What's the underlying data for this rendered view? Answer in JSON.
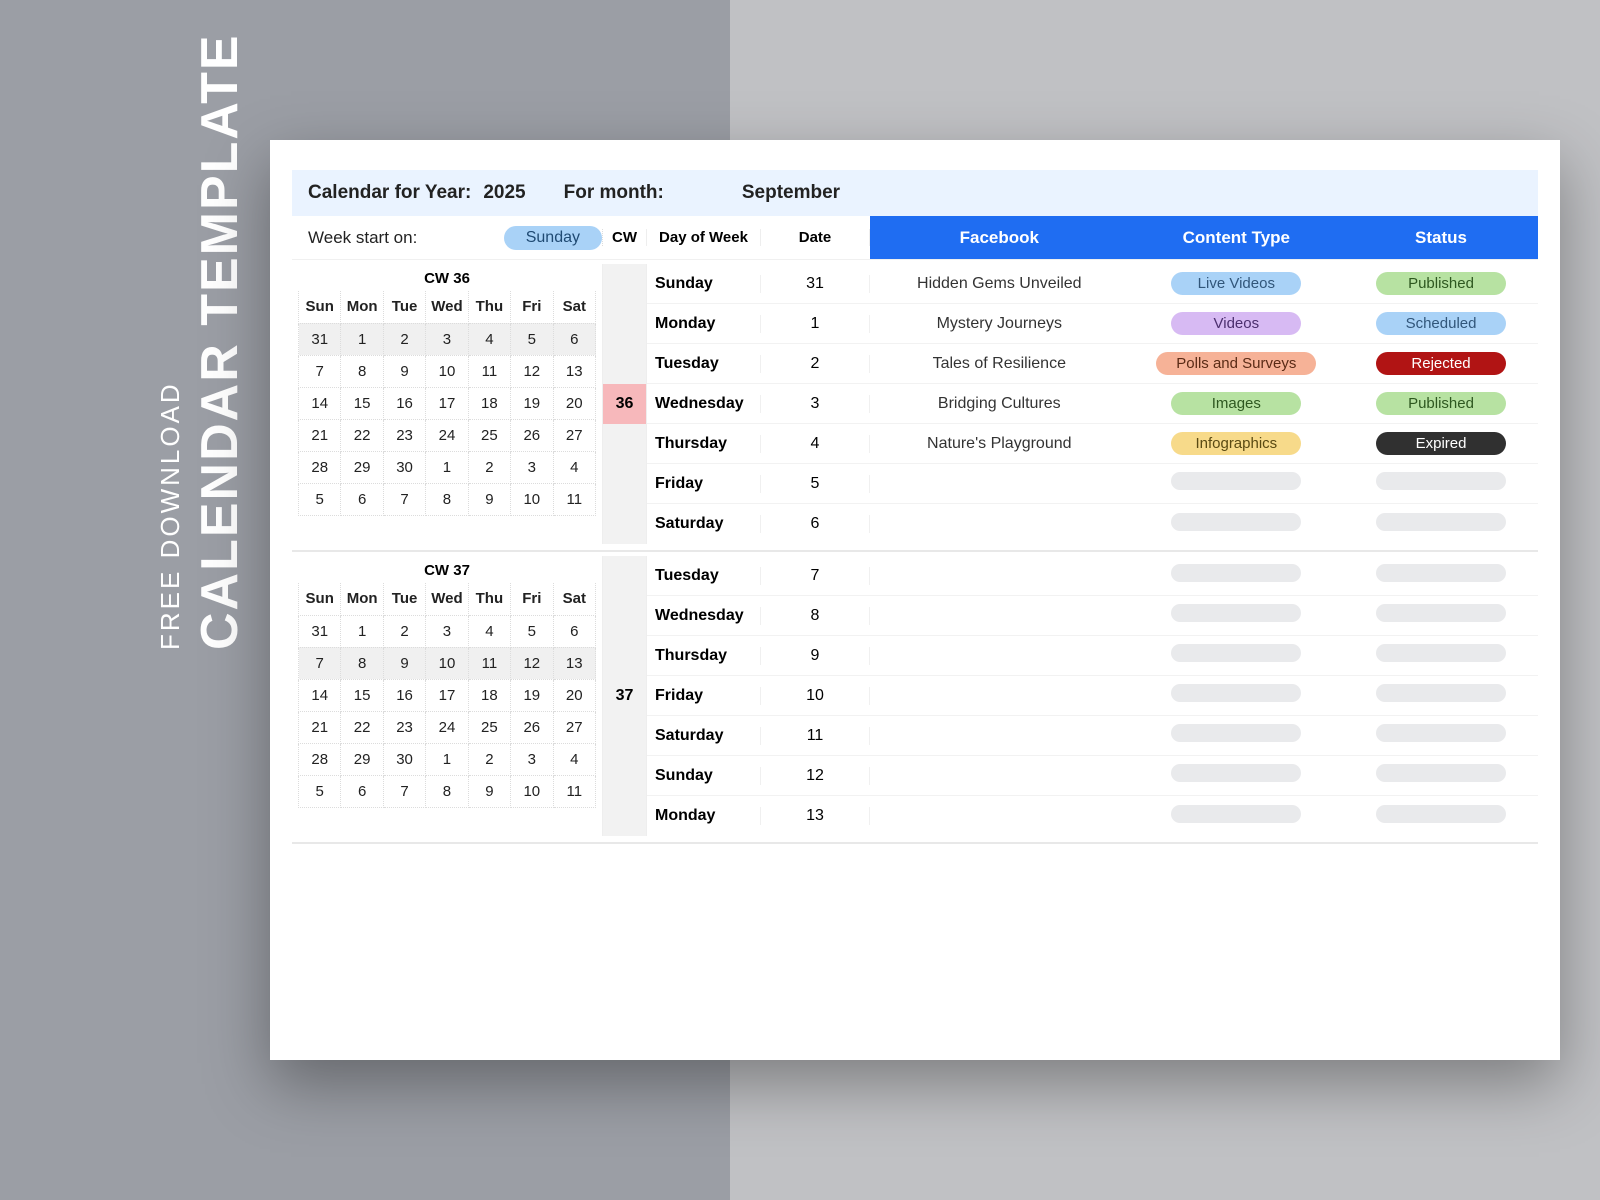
{
  "side": {
    "small": "FREE DOWNLOAD",
    "big": "CALENDAR TEMPLATE"
  },
  "header": {
    "label_year": "Calendar for Year:",
    "year": "2025",
    "label_month": "For month:",
    "month": "September"
  },
  "weekstart": {
    "label": "Week start on:",
    "value": "Sunday"
  },
  "col_heads": {
    "cw": "CW",
    "dow": "Day of Week",
    "date": "Date",
    "fb": "Facebook",
    "ct": "Content Type",
    "st": "Status"
  },
  "blocks": [
    {
      "cw_label": "CW  36",
      "cw_num": "36",
      "cw_num_row": 3,
      "cw_hl": true,
      "mini": {
        "head": [
          "Sun",
          "Mon",
          "Tue",
          "Wed",
          "Thu",
          "Fri",
          "Sat"
        ],
        "rows": [
          [
            {
              "v": "31",
              "shade": true
            },
            {
              "v": "1",
              "shade": true
            },
            {
              "v": "2",
              "shade": true
            },
            {
              "v": "3",
              "shade": true
            },
            {
              "v": "4",
              "shade": true
            },
            {
              "v": "5",
              "shade": true
            },
            {
              "v": "6",
              "shade": true
            }
          ],
          [
            {
              "v": "7"
            },
            {
              "v": "8"
            },
            {
              "v": "9"
            },
            {
              "v": "10"
            },
            {
              "v": "11"
            },
            {
              "v": "12"
            },
            {
              "v": "13"
            }
          ],
          [
            {
              "v": "14"
            },
            {
              "v": "15"
            },
            {
              "v": "16"
            },
            {
              "v": "17"
            },
            {
              "v": "18"
            },
            {
              "v": "19"
            },
            {
              "v": "20"
            }
          ],
          [
            {
              "v": "21"
            },
            {
              "v": "22"
            },
            {
              "v": "23"
            },
            {
              "v": "24"
            },
            {
              "v": "25"
            },
            {
              "v": "26"
            },
            {
              "v": "27"
            }
          ],
          [
            {
              "v": "28"
            },
            {
              "v": "29"
            },
            {
              "v": "30"
            },
            {
              "v": "1"
            },
            {
              "v": "2"
            },
            {
              "v": "3"
            },
            {
              "v": "4",
              "red": true
            }
          ],
          [
            {
              "v": "5"
            },
            {
              "v": "6"
            },
            {
              "v": "7"
            },
            {
              "v": "8"
            },
            {
              "v": "9"
            },
            {
              "v": "10"
            },
            {
              "v": "11"
            }
          ]
        ]
      },
      "days": [
        {
          "dow": "Sunday",
          "date": "31",
          "fb": "Hidden Gems Unveiled",
          "ct": "Live Videos",
          "ct_cls": "p-live",
          "st": "Published",
          "st_cls": "p-pub"
        },
        {
          "dow": "Monday",
          "date": "1",
          "fb": "Mystery Journeys",
          "ct": "Videos",
          "ct_cls": "p-video",
          "st": "Scheduled",
          "st_cls": "p-sched"
        },
        {
          "dow": "Tuesday",
          "date": "2",
          "fb": "Tales of Resilience",
          "ct": "Polls and Surveys",
          "ct_cls": "p-polls",
          "st": "Rejected",
          "st_cls": "p-rej"
        },
        {
          "dow": "Wednesday",
          "date": "3",
          "fb": "Bridging Cultures",
          "ct": "Images",
          "ct_cls": "p-images",
          "st": "Published",
          "st_cls": "p-pub"
        },
        {
          "dow": "Thursday",
          "date": "4",
          "fb": "Nature's Playground",
          "ct": "Infographics",
          "ct_cls": "p-info",
          "st": "Expired",
          "st_cls": "p-exp"
        },
        {
          "dow": "Friday",
          "date": "5"
        },
        {
          "dow": "Saturday",
          "date": "6"
        }
      ]
    },
    {
      "cw_label": "CW  37",
      "cw_num": "37",
      "cw_num_row": 3,
      "cw_hl": false,
      "mini": {
        "head": [
          "Sun",
          "Mon",
          "Tue",
          "Wed",
          "Thu",
          "Fri",
          "Sat"
        ],
        "rows": [
          [
            {
              "v": "31"
            },
            {
              "v": "1"
            },
            {
              "v": "2"
            },
            {
              "v": "3"
            },
            {
              "v": "4"
            },
            {
              "v": "5"
            },
            {
              "v": "6"
            }
          ],
          [
            {
              "v": "7",
              "shade": true
            },
            {
              "v": "8",
              "shade": true
            },
            {
              "v": "9",
              "shade": true
            },
            {
              "v": "10",
              "shade": true
            },
            {
              "v": "11",
              "shade": true
            },
            {
              "v": "12",
              "shade": true
            },
            {
              "v": "13",
              "shade": true
            }
          ],
          [
            {
              "v": "14"
            },
            {
              "v": "15"
            },
            {
              "v": "16"
            },
            {
              "v": "17"
            },
            {
              "v": "18"
            },
            {
              "v": "19"
            },
            {
              "v": "20"
            }
          ],
          [
            {
              "v": "21"
            },
            {
              "v": "22"
            },
            {
              "v": "23"
            },
            {
              "v": "24"
            },
            {
              "v": "25"
            },
            {
              "v": "26"
            },
            {
              "v": "27"
            }
          ],
          [
            {
              "v": "28"
            },
            {
              "v": "29"
            },
            {
              "v": "30"
            },
            {
              "v": "1"
            },
            {
              "v": "2"
            },
            {
              "v": "3"
            },
            {
              "v": "4",
              "red": true
            }
          ],
          [
            {
              "v": "5"
            },
            {
              "v": "6"
            },
            {
              "v": "7"
            },
            {
              "v": "8"
            },
            {
              "v": "9"
            },
            {
              "v": "10"
            },
            {
              "v": "11"
            }
          ]
        ]
      },
      "days": [
        {
          "dow": "Tuesday",
          "date": "7"
        },
        {
          "dow": "Wednesday",
          "date": "8"
        },
        {
          "dow": "Thursday",
          "date": "9"
        },
        {
          "dow": "Friday",
          "date": "10"
        },
        {
          "dow": "Saturday",
          "date": "11"
        },
        {
          "dow": "Sunday",
          "date": "12"
        },
        {
          "dow": "Monday",
          "date": "13"
        }
      ]
    }
  ]
}
